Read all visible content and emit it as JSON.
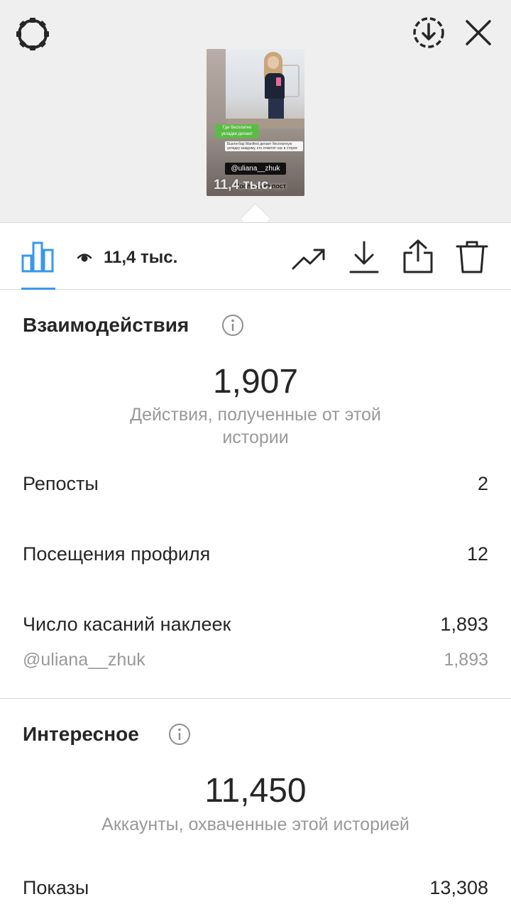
{
  "story_preview": {
    "sticker_green_text": "Где бесплатно укладки делают",
    "sticker_white_text": "Бьюти-бар Manifest делает бесплатную укладку каждому, кто отметит нас в сторис",
    "mention_text": "@uliana__zhuk",
    "last_text": "Последний пост",
    "overlay_views": "11,4 тыс."
  },
  "tabbar": {
    "views_count": "11,4 тыс.",
    "active_color": "#3897f0"
  },
  "interactions": {
    "title": "Взаимодействия",
    "total": "1,907",
    "caption": "Действия, полученные от этой истории",
    "rows": [
      {
        "label": "Репосты",
        "value": "2"
      },
      {
        "label": "Посещения профиля",
        "value": "12"
      },
      {
        "label": "Число касаний наклеек",
        "value": "1,893"
      }
    ],
    "sticker_breakdown": {
      "label": "@uliana__zhuk",
      "value": "1,893"
    }
  },
  "discovery": {
    "title": "Интересное",
    "total": "11,450",
    "caption": "Аккаунты, охваченные этой историей",
    "rows": [
      {
        "label": "Показы",
        "value": "13,308"
      }
    ]
  }
}
